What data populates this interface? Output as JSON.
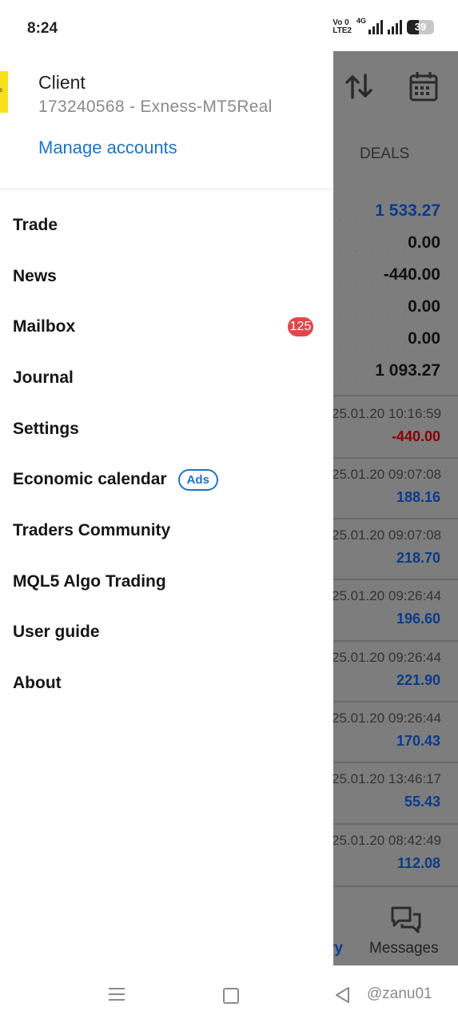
{
  "status": {
    "time": "8:24",
    "volte_top": "Vo 0",
    "volte_bottom": "LTE2",
    "network": "4G",
    "battery": "39"
  },
  "drawer": {
    "client_name": "Client",
    "account": "173240568 - Exness-MT5Real",
    "manage_accounts": "Manage accounts",
    "items": [
      {
        "label": "Trade"
      },
      {
        "label": "News"
      },
      {
        "label": "Mailbox",
        "badge": "125"
      },
      {
        "label": "Journal"
      },
      {
        "label": "Settings"
      },
      {
        "label": "Economic calendar",
        "tag": "Ads"
      },
      {
        "label": "Traders Community"
      },
      {
        "label": "MQL5 Algo Trading"
      },
      {
        "label": "User guide"
      },
      {
        "label": "About"
      }
    ]
  },
  "background": {
    "tab_label": "DEALS",
    "summary": [
      "1 533.27",
      "0.00",
      "-440.00",
      "0.00",
      "0.00",
      "1 093.27"
    ],
    "deals": [
      {
        "time": "25.01.20 10:16:59",
        "amount": "-440.00"
      },
      {
        "time": "25.01.20 09:07:08",
        "amount": "188.16"
      },
      {
        "time": "25.01.20 09:07:08",
        "amount": "218.70"
      },
      {
        "time": "25.01.20 09:26:44",
        "amount": "196.60"
      },
      {
        "time": "25.01.20 09:26:44",
        "amount": "221.90"
      },
      {
        "time": "25.01.20 09:26:44",
        "amount": "170.43"
      },
      {
        "time": "25.01.20 13:46:17",
        "amount": "55.43"
      },
      {
        "time": "25.01.20 08:42:49",
        "amount": "112.08"
      }
    ],
    "bottom_nav": {
      "history_partial": "ry",
      "messages": "Messages"
    }
  },
  "watermark": "@zanu01",
  "colors": {
    "accent": "#1e73c8",
    "badge": "#e0464a",
    "overlay": "#7d7d7d",
    "profit": "#0c3a8c",
    "loss": "#8b0000"
  }
}
